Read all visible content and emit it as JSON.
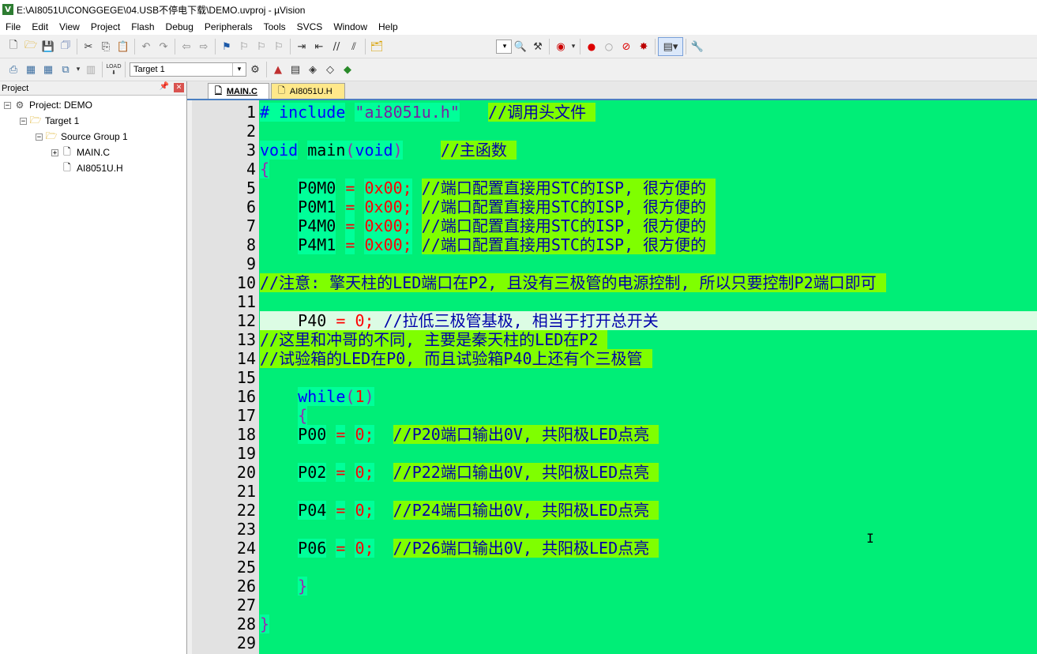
{
  "window": {
    "title": "E:\\AI8051U\\CONGGEGE\\04.USB不停电下载\\DEMO.uvproj - µVision",
    "app_icon_letter": "V"
  },
  "menu": [
    "File",
    "Edit",
    "View",
    "Project",
    "Flash",
    "Debug",
    "Peripherals",
    "Tools",
    "SVCS",
    "Window",
    "Help"
  ],
  "toolbar2": {
    "target_select": "Target 1",
    "load_label": "LOAD"
  },
  "project_panel": {
    "title": "Project",
    "tree": {
      "project": "Project: DEMO",
      "target": "Target 1",
      "group": "Source Group 1",
      "file1": "MAIN.C",
      "file2": "AI8051U.H"
    }
  },
  "editor": {
    "tabs": [
      {
        "label": "MAIN.C",
        "active": true
      },
      {
        "label": "AI8051U.H",
        "active": false
      }
    ],
    "current_line": 12,
    "line_numbers": [
      "1",
      "2",
      "3",
      "4",
      "5",
      "6",
      "7",
      "8",
      "9",
      "10",
      "11",
      "12",
      "13",
      "14",
      "15",
      "16",
      "17",
      "18",
      "19",
      "20",
      "21",
      "22",
      "23",
      "24",
      "25",
      "26",
      "27",
      "28",
      "29"
    ],
    "lines": {
      "l1": {
        "kw": "# include",
        "str": "\"ai8051u.h\"",
        "cm": "//调用头文件 "
      },
      "l3": {
        "kw": "void",
        "id": "main",
        "br1": "(",
        "kw2": "void",
        "br2": ")",
        "cm": "//主函数 "
      },
      "l4": {
        "br": "{"
      },
      "l5": {
        "id": "P0M0",
        "op": "=",
        "num": "0x00;",
        "cm": "//端口配置直接用STC的ISP, 很方便的 "
      },
      "l6": {
        "id": "P0M1",
        "op": "=",
        "num": "0x00;",
        "cm": "//端口配置直接用STC的ISP, 很方便的 "
      },
      "l7": {
        "id": "P4M0",
        "op": "=",
        "num": "0x00;",
        "cm": "//端口配置直接用STC的ISP, 很方便的 "
      },
      "l8": {
        "id": "P4M1",
        "op": "=",
        "num": "0x00;",
        "cm": "//端口配置直接用STC的ISP, 很方便的 "
      },
      "l10": {
        "cm": "//注意: 擎天柱的LED端口在P2, 且没有三极管的电源控制, 所以只要控制P2端口即可 "
      },
      "l12": {
        "id": "P40",
        "op": "=",
        "num": "0;",
        "cm": "//拉低三极管基极, 相当于打开总开关"
      },
      "l13": {
        "cm": "//这里和冲哥的不同, 主要是秦天柱的LED在P2 "
      },
      "l14": {
        "cm": "//试验箱的LED在P0, 而且试验箱P40上还有个三极管 "
      },
      "l16": {
        "kw": "while",
        "br1": "(",
        "num": "1",
        "br2": ")"
      },
      "l17": {
        "br": "{"
      },
      "l18": {
        "id": "P00",
        "op": "=",
        "num": "0;",
        "cm": "//P20端口输出0V, 共阳极LED点亮 "
      },
      "l20": {
        "id": "P02",
        "op": "=",
        "num": "0;",
        "cm": "//P22端口输出0V, 共阳极LED点亮 "
      },
      "l22": {
        "id": "P04",
        "op": "=",
        "num": "0;",
        "cm": "//P24端口输出0V, 共阳极LED点亮 "
      },
      "l24": {
        "id": "P06",
        "op": "=",
        "num": "0;",
        "cm": "//P26端口输出0V, 共阳极LED点亮 "
      },
      "l26": {
        "br": "}"
      },
      "l28": {
        "br": "}"
      }
    }
  },
  "colors": {
    "editor_bg": "#00ee77",
    "token_bg": "#00ff99",
    "comment_bg": "#7fff00",
    "keyword": "#0000ff",
    "number": "#ff0000",
    "string": "#7b1fa2"
  }
}
